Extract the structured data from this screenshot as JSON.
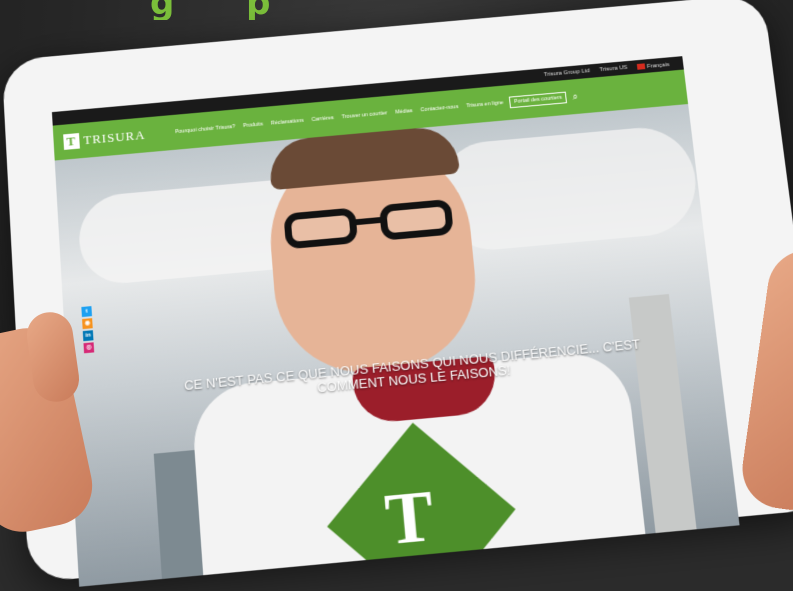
{
  "topbar": {
    "links": [
      "Trisura Group Ltd",
      "Trisura US"
    ],
    "language": "Français"
  },
  "navbar": {
    "logo_text": "TRISURA",
    "items": [
      "Pourquoi choisir Trisura?",
      "Produits",
      "Réclamations",
      "Carrières",
      "Trouver un courtier",
      "Médias",
      "Contactez-nous",
      "Trisura en ligne"
    ],
    "portal_button": "Portail des courtiers"
  },
  "hero": {
    "caption": "CE N'EST PAS CE QUE NOUS FAISONS QUI NOUS DIFFÉRENCIE... C'EST COMMENT NOUS LE FAISONS!",
    "emblem_letter": "T"
  },
  "social": {
    "items": [
      "twitter",
      "rss",
      "in",
      "instagram"
    ]
  },
  "colors": {
    "brand_green": "#6ab23e",
    "topbar": "#1a1a1a"
  }
}
